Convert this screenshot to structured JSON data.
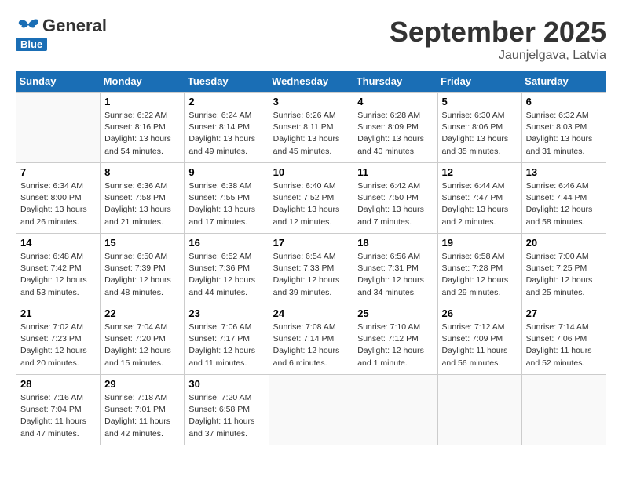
{
  "logo": {
    "general": "General",
    "blue": "Blue"
  },
  "header": {
    "month": "September 2025",
    "location": "Jaunjelgava, Latvia"
  },
  "weekdays": [
    "Sunday",
    "Monday",
    "Tuesday",
    "Wednesday",
    "Thursday",
    "Friday",
    "Saturday"
  ],
  "weeks": [
    [
      {
        "day": "",
        "sunrise": "",
        "sunset": "",
        "daylight": ""
      },
      {
        "day": "1",
        "sunrise": "Sunrise: 6:22 AM",
        "sunset": "Sunset: 8:16 PM",
        "daylight": "Daylight: 13 hours and 54 minutes."
      },
      {
        "day": "2",
        "sunrise": "Sunrise: 6:24 AM",
        "sunset": "Sunset: 8:14 PM",
        "daylight": "Daylight: 13 hours and 49 minutes."
      },
      {
        "day": "3",
        "sunrise": "Sunrise: 6:26 AM",
        "sunset": "Sunset: 8:11 PM",
        "daylight": "Daylight: 13 hours and 45 minutes."
      },
      {
        "day": "4",
        "sunrise": "Sunrise: 6:28 AM",
        "sunset": "Sunset: 8:09 PM",
        "daylight": "Daylight: 13 hours and 40 minutes."
      },
      {
        "day": "5",
        "sunrise": "Sunrise: 6:30 AM",
        "sunset": "Sunset: 8:06 PM",
        "daylight": "Daylight: 13 hours and 35 minutes."
      },
      {
        "day": "6",
        "sunrise": "Sunrise: 6:32 AM",
        "sunset": "Sunset: 8:03 PM",
        "daylight": "Daylight: 13 hours and 31 minutes."
      }
    ],
    [
      {
        "day": "7",
        "sunrise": "Sunrise: 6:34 AM",
        "sunset": "Sunset: 8:00 PM",
        "daylight": "Daylight: 13 hours and 26 minutes."
      },
      {
        "day": "8",
        "sunrise": "Sunrise: 6:36 AM",
        "sunset": "Sunset: 7:58 PM",
        "daylight": "Daylight: 13 hours and 21 minutes."
      },
      {
        "day": "9",
        "sunrise": "Sunrise: 6:38 AM",
        "sunset": "Sunset: 7:55 PM",
        "daylight": "Daylight: 13 hours and 17 minutes."
      },
      {
        "day": "10",
        "sunrise": "Sunrise: 6:40 AM",
        "sunset": "Sunset: 7:52 PM",
        "daylight": "Daylight: 13 hours and 12 minutes."
      },
      {
        "day": "11",
        "sunrise": "Sunrise: 6:42 AM",
        "sunset": "Sunset: 7:50 PM",
        "daylight": "Daylight: 13 hours and 7 minutes."
      },
      {
        "day": "12",
        "sunrise": "Sunrise: 6:44 AM",
        "sunset": "Sunset: 7:47 PM",
        "daylight": "Daylight: 13 hours and 2 minutes."
      },
      {
        "day": "13",
        "sunrise": "Sunrise: 6:46 AM",
        "sunset": "Sunset: 7:44 PM",
        "daylight": "Daylight: 12 hours and 58 minutes."
      }
    ],
    [
      {
        "day": "14",
        "sunrise": "Sunrise: 6:48 AM",
        "sunset": "Sunset: 7:42 PM",
        "daylight": "Daylight: 12 hours and 53 minutes."
      },
      {
        "day": "15",
        "sunrise": "Sunrise: 6:50 AM",
        "sunset": "Sunset: 7:39 PM",
        "daylight": "Daylight: 12 hours and 48 minutes."
      },
      {
        "day": "16",
        "sunrise": "Sunrise: 6:52 AM",
        "sunset": "Sunset: 7:36 PM",
        "daylight": "Daylight: 12 hours and 44 minutes."
      },
      {
        "day": "17",
        "sunrise": "Sunrise: 6:54 AM",
        "sunset": "Sunset: 7:33 PM",
        "daylight": "Daylight: 12 hours and 39 minutes."
      },
      {
        "day": "18",
        "sunrise": "Sunrise: 6:56 AM",
        "sunset": "Sunset: 7:31 PM",
        "daylight": "Daylight: 12 hours and 34 minutes."
      },
      {
        "day": "19",
        "sunrise": "Sunrise: 6:58 AM",
        "sunset": "Sunset: 7:28 PM",
        "daylight": "Daylight: 12 hours and 29 minutes."
      },
      {
        "day": "20",
        "sunrise": "Sunrise: 7:00 AM",
        "sunset": "Sunset: 7:25 PM",
        "daylight": "Daylight: 12 hours and 25 minutes."
      }
    ],
    [
      {
        "day": "21",
        "sunrise": "Sunrise: 7:02 AM",
        "sunset": "Sunset: 7:23 PM",
        "daylight": "Daylight: 12 hours and 20 minutes."
      },
      {
        "day": "22",
        "sunrise": "Sunrise: 7:04 AM",
        "sunset": "Sunset: 7:20 PM",
        "daylight": "Daylight: 12 hours and 15 minutes."
      },
      {
        "day": "23",
        "sunrise": "Sunrise: 7:06 AM",
        "sunset": "Sunset: 7:17 PM",
        "daylight": "Daylight: 12 hours and 11 minutes."
      },
      {
        "day": "24",
        "sunrise": "Sunrise: 7:08 AM",
        "sunset": "Sunset: 7:14 PM",
        "daylight": "Daylight: 12 hours and 6 minutes."
      },
      {
        "day": "25",
        "sunrise": "Sunrise: 7:10 AM",
        "sunset": "Sunset: 7:12 PM",
        "daylight": "Daylight: 12 hours and 1 minute."
      },
      {
        "day": "26",
        "sunrise": "Sunrise: 7:12 AM",
        "sunset": "Sunset: 7:09 PM",
        "daylight": "Daylight: 11 hours and 56 minutes."
      },
      {
        "day": "27",
        "sunrise": "Sunrise: 7:14 AM",
        "sunset": "Sunset: 7:06 PM",
        "daylight": "Daylight: 11 hours and 52 minutes."
      }
    ],
    [
      {
        "day": "28",
        "sunrise": "Sunrise: 7:16 AM",
        "sunset": "Sunset: 7:04 PM",
        "daylight": "Daylight: 11 hours and 47 minutes."
      },
      {
        "day": "29",
        "sunrise": "Sunrise: 7:18 AM",
        "sunset": "Sunset: 7:01 PM",
        "daylight": "Daylight: 11 hours and 42 minutes."
      },
      {
        "day": "30",
        "sunrise": "Sunrise: 7:20 AM",
        "sunset": "Sunset: 6:58 PM",
        "daylight": "Daylight: 11 hours and 37 minutes."
      },
      {
        "day": "",
        "sunrise": "",
        "sunset": "",
        "daylight": ""
      },
      {
        "day": "",
        "sunrise": "",
        "sunset": "",
        "daylight": ""
      },
      {
        "day": "",
        "sunrise": "",
        "sunset": "",
        "daylight": ""
      },
      {
        "day": "",
        "sunrise": "",
        "sunset": "",
        "daylight": ""
      }
    ]
  ]
}
